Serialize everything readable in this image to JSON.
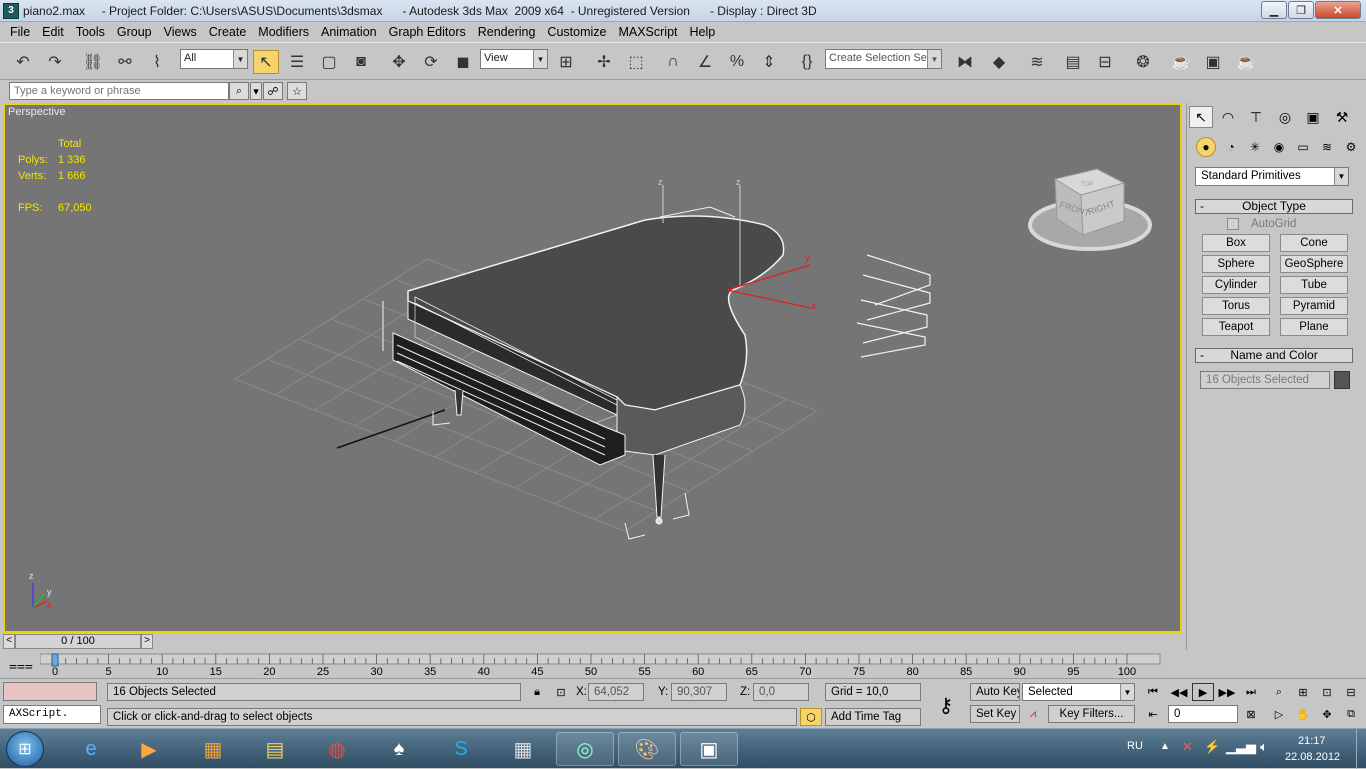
{
  "window": {
    "title": "piano2.max     - Project Folder: C:\\Users\\ASUS\\Documents\\3dsmax      - Autodesk 3ds Max  2009 x64  - Unregistered Version      - Display : Direct 3D",
    "app_icon": "3ds-max-icon"
  },
  "menu": [
    "File",
    "Edit",
    "Tools",
    "Group",
    "Views",
    "Create",
    "Modifiers",
    "Animation",
    "Graph Editors",
    "Rendering",
    "Customize",
    "MAXScript",
    "Help"
  ],
  "toolbar": {
    "selection_filter": "All",
    "reference_coord": "View",
    "named_selection_placeholder": "Create Selection Set"
  },
  "search": {
    "placeholder": "Type a keyword or phrase"
  },
  "viewport": {
    "label": "Perspective",
    "stats_header": "Total",
    "polys_label": "Polys:",
    "polys_value": "1 336",
    "verts_label": "Verts:",
    "verts_value": "1 666",
    "fps_label": "FPS:",
    "fps_value": "67,050",
    "viewcube_front": "FRONT",
    "viewcube_right": "RIGHT",
    "viewcube_top": "TOP",
    "axis_z": "z",
    "axis_y": "y",
    "axis_x": "x"
  },
  "command_panel": {
    "category": "Standard Primitives",
    "object_type_header": "Object Type",
    "autogrid": "AutoGrid",
    "buttons": [
      "Box",
      "Cone",
      "Sphere",
      "GeoSphere",
      "Cylinder",
      "Tube",
      "Torus",
      "Pyramid",
      "Teapot",
      "Plane"
    ],
    "name_color_header": "Name and Color",
    "name_value": "16 Objects Selected",
    "collapse": "-"
  },
  "timeline": {
    "frame_display": "0 / 100",
    "prev": "<",
    "next": ">",
    "ticks": [
      "0",
      "5",
      "10",
      "15",
      "20",
      "25",
      "30",
      "35",
      "40",
      "45",
      "50",
      "55",
      "60",
      "65",
      "70",
      "75",
      "80",
      "85",
      "90",
      "95",
      "100"
    ]
  },
  "status": {
    "maxscript_label": "AXScript.",
    "selection_text": "16 Objects Selected",
    "prompt_text": "Click or click-and-drag to select objects",
    "x_label": "X:",
    "x_value": "64,052",
    "y_label": "Y:",
    "y_value": "90,307",
    "z_label": "Z:",
    "z_value": "0,0",
    "grid_text": "Grid = 10,0",
    "add_time_tag": "Add Time Tag",
    "auto_key": "Auto Key",
    "set_key": "Set Key",
    "selected_combo": "Selected",
    "key_filters": "Key Filters...",
    "current_frame": "0"
  },
  "taskbar": {
    "language": "RU",
    "time": "21:17",
    "date": "22.08.2012"
  }
}
